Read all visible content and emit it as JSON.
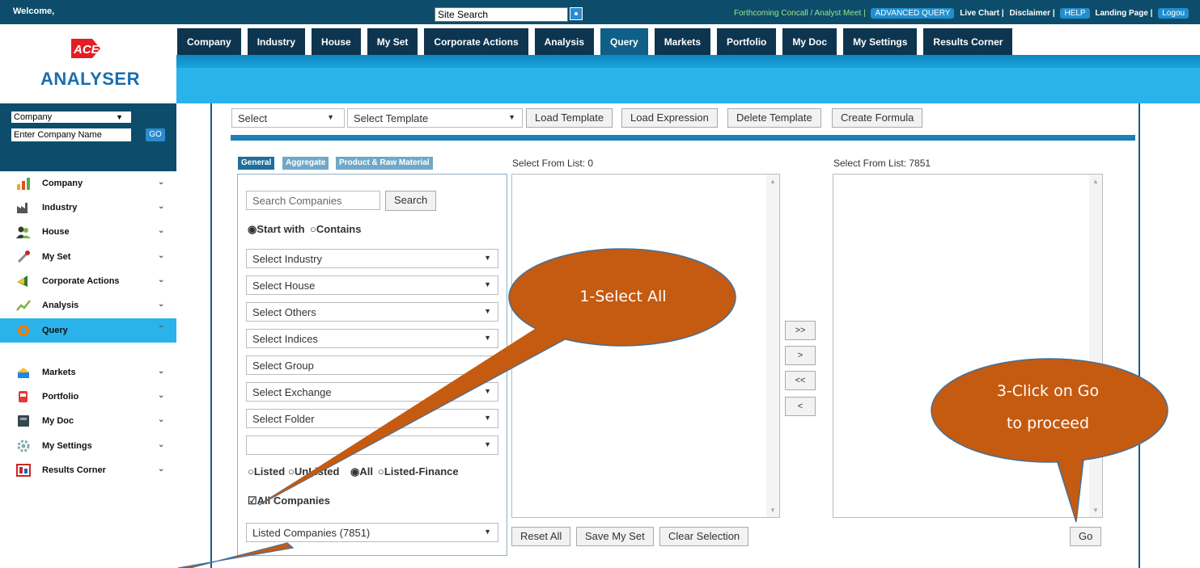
{
  "topbar": {
    "welcome": "Welcome,",
    "site_search": "Site Search",
    "forthcoming": "Forthcoming Concall / Analyst Meet |",
    "advanced_query": "ADVANCED QUERY",
    "live_chart": "Live Chart |",
    "disclaimer": "Disclaimer |",
    "help": "HELP",
    "landing_page": "Landing Page |",
    "logout": "Logou"
  },
  "tabs": [
    "Company",
    "Industry",
    "House",
    "My Set",
    "Corporate Actions",
    "Analysis",
    "Query",
    "Markets",
    "Portfolio",
    "My Doc",
    "My Settings",
    "Results Corner"
  ],
  "logo": {
    "text": "ANALYSER",
    "mark": "ACE"
  },
  "sidebar": {
    "company_select": "Company",
    "company_name_input": "Enter Company Name",
    "go": "GO",
    "items": [
      "Company",
      "Industry",
      "House",
      "My Set",
      "Corporate Actions",
      "Analysis",
      "Query",
      "Markets",
      "Portfolio",
      "My Doc",
      "My Settings",
      "Results Corner"
    ]
  },
  "toolbar": {
    "select": "Select",
    "select_template": "Select Template",
    "load_template": "Load Template",
    "load_expression": "Load Expression",
    "delete_template": "Delete Template",
    "create_formula": "Create Formula"
  },
  "subtabs": [
    "General",
    "Aggregate",
    "Product & Raw Material"
  ],
  "filters": {
    "search_placeholder": "Search Companies",
    "search_button": "Search",
    "start_with": "Start with",
    "contains": "Contains",
    "dropdowns": [
      "Select Industry",
      "Select House",
      "Select Others",
      "Select Indices",
      "Select Group",
      "Select Exchange",
      "Select Folder",
      ""
    ],
    "listed": "Listed",
    "unlisted": "UnListed",
    "all": "All",
    "listed_finance": "Listed-Finance",
    "all_companies": "All Companies",
    "listed_companies": "Listed Companies (7851)"
  },
  "lists": {
    "left_label": "Select From List: 0",
    "right_label": "Select From List: 7851",
    "move_buttons": [
      ">>",
      ">",
      "<<",
      "<"
    ],
    "reset_all": "Reset All",
    "save_my_set": "Save My Set",
    "clear_selection": "Clear Selection",
    "go": "Go"
  },
  "callouts": {
    "select_all": "1-Select All",
    "click_go_line1": "3-Click on Go",
    "click_go_line2": "to proceed",
    "fill_color": "#c55a11"
  }
}
